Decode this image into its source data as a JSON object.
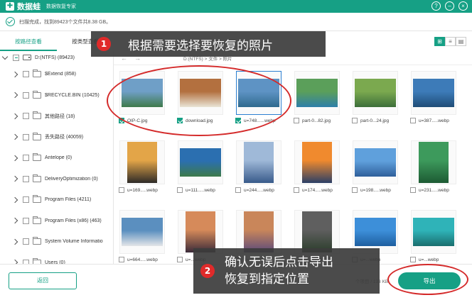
{
  "app": {
    "name": "数据蛙",
    "subtitle": "数据恢复专家",
    "window_controls": [
      "?",
      "–",
      "×"
    ]
  },
  "status": {
    "text": "扫描完成，找到89423个文件共8.38 GB。"
  },
  "tabs": [
    {
      "label": "按路径查看",
      "active": true
    },
    {
      "label": "按类型查看",
      "active": false
    }
  ],
  "tree": {
    "root": {
      "label": "D:(NTFS)  (89423)"
    },
    "items": [
      {
        "label": "$Extend  (858)"
      },
      {
        "label": "$RECYCLE.BIN  (10425)"
      },
      {
        "label": "其他路径  (18)"
      },
      {
        "label": "丢失路径  (40059)"
      },
      {
        "label": "Antelope  (0)"
      },
      {
        "label": "DeliveryOptimization  (0)"
      },
      {
        "label": "Program Files  (4211)"
      },
      {
        "label": "Program Files (x86)  (463)"
      },
      {
        "label": "System Volume Informatio"
      },
      {
        "label": "Users  (0)"
      }
    ]
  },
  "toolbar": {
    "path": "D:(NTFS) > 文件 > 照片",
    "view_modes": [
      "⊞",
      "≡",
      "▤"
    ]
  },
  "thumbnails": [
    {
      "name": "OIP-C.jpg",
      "checked": true,
      "selected": false,
      "colors": [
        "#6f9fc7",
        "#3f7a4b"
      ],
      "portrait": false
    },
    {
      "name": "download.jpg",
      "checked": true,
      "selected": false,
      "colors": [
        "#b3703f",
        "#e9e4d6"
      ],
      "portrait": false
    },
    {
      "name": "u=748......webp",
      "checked": true,
      "selected": true,
      "colors": [
        "#5e93c4",
        "#2f6a8e"
      ],
      "portrait": false
    },
    {
      "name": "part-0...82.jpg",
      "checked": false,
      "selected": false,
      "colors": [
        "#5b9f5a",
        "#2e7fa9"
      ],
      "portrait": false
    },
    {
      "name": "part-0...24.jpg",
      "checked": false,
      "selected": false,
      "colors": [
        "#7ba94f",
        "#3c6e3a"
      ],
      "portrait": false
    },
    {
      "name": "u=387.....webp",
      "checked": false,
      "selected": false,
      "colors": [
        "#3d7bb8",
        "#1f4d76"
      ],
      "portrait": false
    },
    {
      "name": "u=169.....webp",
      "checked": false,
      "selected": false,
      "colors": [
        "#e3a548",
        "#2d2a28"
      ],
      "portrait": true
    },
    {
      "name": "u=111.....webp",
      "checked": false,
      "selected": false,
      "colors": [
        "#2b6fb0",
        "#3d7a4a"
      ],
      "portrait": false
    },
    {
      "name": "u=244.....webp",
      "checked": false,
      "selected": false,
      "colors": [
        "#9fb9d8",
        "#385a8a"
      ],
      "portrait": true
    },
    {
      "name": "u=174.....webp",
      "checked": false,
      "selected": false,
      "colors": [
        "#f08a2e",
        "#2b3f66"
      ],
      "portrait": true
    },
    {
      "name": "u=198.....webp",
      "checked": false,
      "selected": false,
      "colors": [
        "#5fa0dc",
        "#2f5f9a"
      ],
      "portrait": false
    },
    {
      "name": "u=231.....webp",
      "checked": false,
      "selected": false,
      "colors": [
        "#3d9a5c",
        "#1d5a33"
      ],
      "portrait": true
    },
    {
      "name": "u=664.....webp",
      "checked": false,
      "selected": false,
      "colors": [
        "#5b8fbf",
        "#e4e6e8"
      ],
      "portrait": false
    },
    {
      "name": "u=...webp",
      "checked": false,
      "selected": false,
      "colors": [
        "#d68a5a",
        "#3b2a3a"
      ],
      "portrait": true
    },
    {
      "name": "u=...webp",
      "checked": false,
      "selected": false,
      "colors": [
        "#c9865a",
        "#5b4a7a"
      ],
      "portrait": true
    },
    {
      "name": "u=...webp",
      "checked": false,
      "selected": false,
      "colors": [
        "#5f5f5f",
        "#2b3d2b"
      ],
      "portrait": true
    },
    {
      "name": "u=...webp",
      "checked": false,
      "selected": false,
      "colors": [
        "#3d8fd9",
        "#1e5fa0"
      ],
      "portrait": false
    },
    {
      "name": "u=...webp",
      "checked": false,
      "selected": false,
      "colors": [
        "#2fb3b8",
        "#1a6e6e"
      ],
      "portrait": false
    }
  ],
  "bottom": {
    "back_label": "返回",
    "size_text": "个项目 / 133 KB",
    "export_label": "导出"
  },
  "annotations": {
    "step1": {
      "num": "1",
      "text": "根据需要选择要恢复的照片"
    },
    "step2": {
      "num": "2",
      "line1": "确认无误后点击导出",
      "line2": "恢复到指定位置"
    }
  },
  "colors": {
    "accent": "#16a085",
    "annotation_red": "#d42a2a",
    "selection_blue": "#2b7fd1"
  }
}
